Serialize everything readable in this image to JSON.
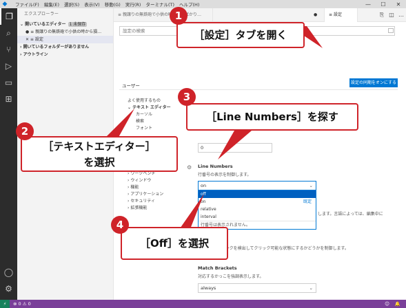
{
  "titlebar": {
    "menu": [
      "ファイル(F)",
      "編集(E)",
      "選択(S)",
      "表示(V)",
      "移動(G)",
      "実行(R)",
      "ターミナル(T)",
      "ヘルプ(H)"
    ],
    "controls": [
      "—",
      "☐",
      "✕"
    ]
  },
  "sidebar": {
    "title": "エクスプローラー",
    "open_editors": "開いているエディター",
    "unsaved_badge": "1 未保存",
    "file1": "親譲りの無鉄砲で小供の時から損…",
    "file2": "設定",
    "no_folder": "開いているフォルダーがありません",
    "outline": "アウトライン"
  },
  "tabs": {
    "tab1": "親譲りの無鉄砲で小供の時から損ばかり…",
    "tab2_dirty": "●",
    "tab3": "設定"
  },
  "settings": {
    "search_placeholder": "設定の検索",
    "user_tab": "ユーザー",
    "sync_button": "設定の同期をオンにする",
    "toc": [
      "よく使用するもの",
      "テキスト エディター",
      "カーソル",
      "検索",
      "フォント",
      "",
      "",
      "",
      "ワークベンチ",
      "ウィンドウ",
      "機能",
      "アプリケーション",
      "セキュリティ",
      "拡張機能"
    ],
    "number_value": "0",
    "line_numbers_label": "Line Numbers",
    "line_numbers_desc": "行番号の表示を制御します。",
    "line_numbers_value": "on",
    "dropdown": {
      "options": [
        "off",
        "on",
        "relative",
        "interval"
      ],
      "default": "既定",
      "option_desc": "行番号は表示されません。"
    },
    "partial_right": "します。言語によっては、編集中に",
    "links_desc": "エディターがリンクを検出してクリック可能な状態にするかどうかを制御します。",
    "match_brackets_label": "Match Brackets",
    "match_brackets_desc": "対応するかっこを強調表示します。",
    "match_brackets_value": "always"
  },
  "status": {
    "errors": "⊗ 0 ⚠ 0"
  },
  "annotations": {
    "a1": {
      "num": "1",
      "text": "［設定］タブを開く"
    },
    "a2": {
      "num": "2",
      "line1": "［テキストエディター］",
      "line2": "を選択"
    },
    "a3": {
      "num": "3",
      "text": "［Line Numbers］を探す"
    },
    "a4": {
      "num": "4",
      "text": "［Off］を選択"
    }
  }
}
